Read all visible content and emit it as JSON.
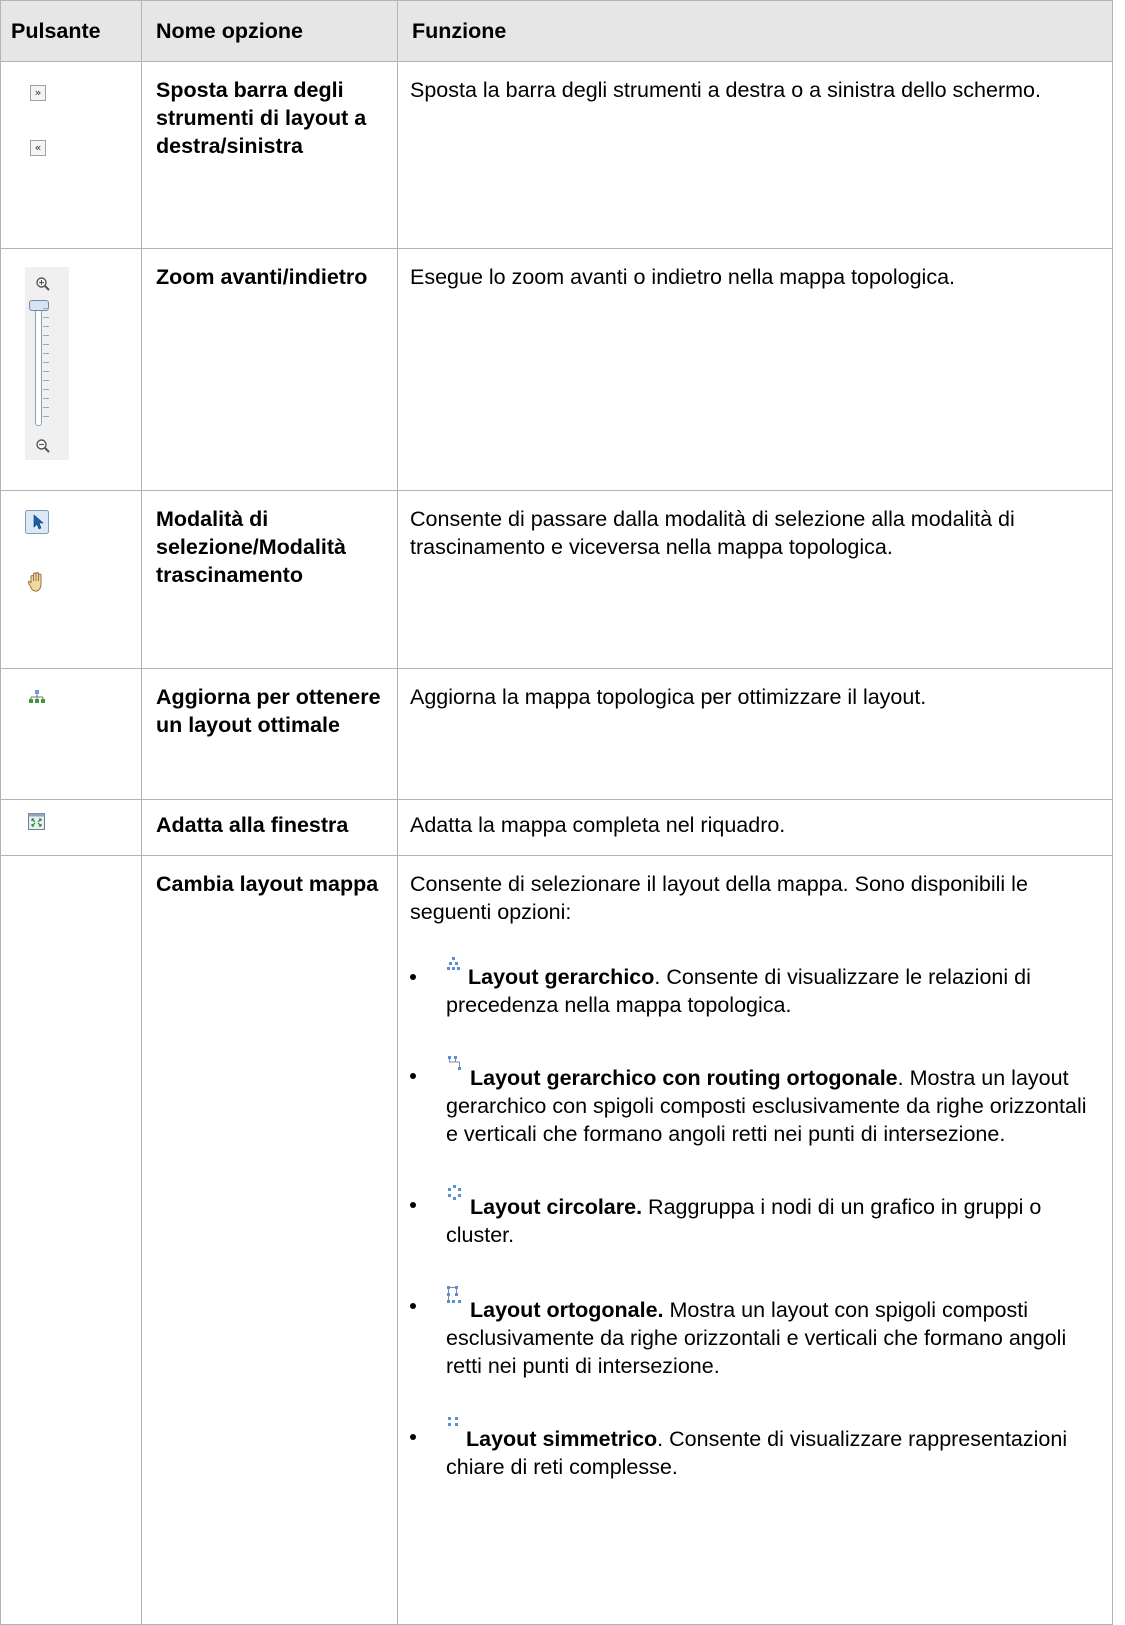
{
  "headers": {
    "col1": "Pulsante",
    "col2": "Nome opzione",
    "col3": "Funzione"
  },
  "rows": [
    {
      "name": "Sposta barra degli strumenti di layout a destra/sinistra",
      "function": "Sposta la barra degli strumenti a destra o a sinistra dello schermo.",
      "icons": [
        "move-right-icon",
        "move-left-icon"
      ]
    },
    {
      "name": "Zoom avanti/indietro",
      "function": "Esegue lo zoom avanti o indietro nella mappa topologica.",
      "icons": [
        "zoom-in-icon",
        "zoom-slider",
        "zoom-out-icon"
      ],
      "zoom_level": 1.0
    },
    {
      "name": "Modalità di selezione/Modalità trascinamento",
      "function": "Consente di passare dalla modalità di selezione alla modalità di trascinamento e viceversa nella mappa topologica.",
      "icons": [
        "select-pointer-icon",
        "hand-drag-icon"
      ]
    },
    {
      "name": "Aggiorna per ottenere un layout ottimale",
      "function": "Aggiorna la mappa topologica per ottimizzare il layout.",
      "icons": [
        "hierarchy-refresh-icon"
      ]
    },
    {
      "name": "Adatta alla finestra",
      "function": "Adatta la mappa completa nel riquadro.",
      "icons": [
        "fit-window-icon"
      ]
    },
    {
      "name": "Cambia layout mappa",
      "function": "Consente di selezionare il layout della mappa. Sono disponibili le seguenti opzioni:",
      "options": [
        {
          "icon": "hierarchical-layout-icon",
          "label": "Layout gerarchico",
          "label_suffix": ".",
          "text": " Consente di visualizzare le relazioni di precedenza nella mappa topologica."
        },
        {
          "icon": "orthogonal-routing-layout-icon",
          "label": "Layout gerarchico con routing ortogonale",
          "label_suffix": ".",
          "text": " Mostra un layout gerarchico con spigoli composti esclusivamente da righe orizzontali e verticali che formano angoli retti nei punti di intersezione."
        },
        {
          "icon": "circular-layout-icon",
          "label": "Layout circolare.",
          "label_suffix": "",
          "text": " Raggruppa i nodi di un grafico in gruppi o cluster."
        },
        {
          "icon": "orthogonal-layout-icon",
          "label": "Layout ortogonale.",
          "label_suffix": "",
          "text": " Mostra un layout con spigoli composti esclusivamente da righe orizzontali e verticali che formano angoli retti nei punti di intersezione."
        },
        {
          "icon": "symmetric-layout-icon",
          "label": "Layout simmetrico",
          "label_suffix": ".",
          "text": " Consente di visualizzare rappresentazioni chiare di reti complesse."
        }
      ]
    }
  ]
}
